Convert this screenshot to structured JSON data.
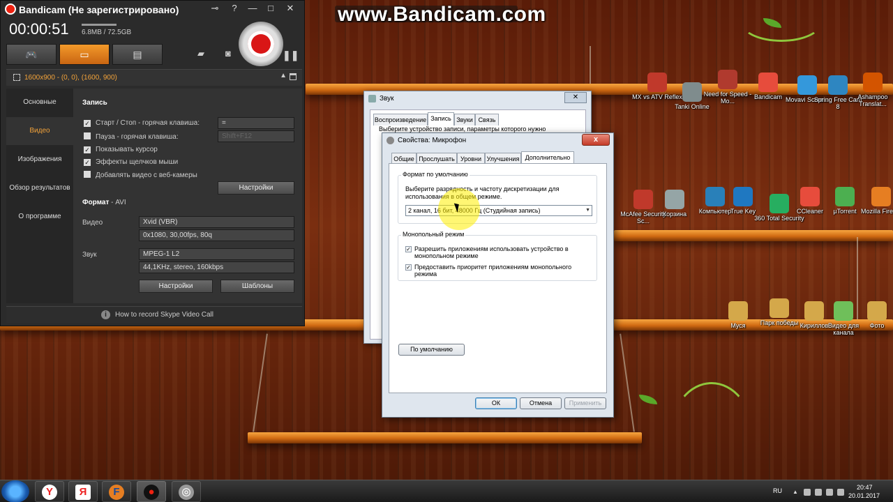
{
  "watermark": "www.Bandicam.com",
  "bandicam": {
    "title": "Bandicam (Не зарегистрировано)",
    "timer": "00:00:51",
    "size": "6.8MB / 72.5GB",
    "region": "1600x900 - (0, 0), (1600, 900)",
    "sidebar": [
      "Основные",
      "Видео",
      "Изображения",
      "Обзор результатов",
      "О программе"
    ],
    "record_section": "Запись",
    "checks": [
      {
        "label": "Старт / Стоп - горячая клавиша:",
        "checked": true
      },
      {
        "label": "Пауза - горячая клавиша:",
        "checked": false
      },
      {
        "label": "Показывать курсор",
        "checked": true
      },
      {
        "label": "Эффекты щелчков мыши",
        "checked": true
      },
      {
        "label": "Добавлять видео с веб-камеры",
        "checked": false
      }
    ],
    "hotkey_start": "=",
    "hotkey_pause": "Shift+F12",
    "settings_button": "Настройки",
    "format_label": "Формат",
    "format_value": "- AVI",
    "video_label": "Видео",
    "video_codec": "Xvid (VBR)",
    "video_params": "0x1080, 30,00fps, 80q",
    "audio_label": "Звук",
    "audio_codec": "MPEG-1 L2",
    "audio_params": "44,1KHz, stereo, 160kbps",
    "settings_button2": "Настройки",
    "templates_button": "Шаблоны",
    "footer": "How to record Skype Video Call"
  },
  "sound_dialog": {
    "title": "Звук",
    "tabs": [
      "Воспроизведение",
      "Запись",
      "Звуки",
      "Связь"
    ],
    "active_tab": 1,
    "text": "Выберите устройство записи, параметры которого нужно"
  },
  "mic_dialog": {
    "title": "Свойства: Микрофон",
    "close": "x",
    "tabs": [
      "Общие",
      "Прослушать",
      "Уровни",
      "Улучшения",
      "Дополнительно"
    ],
    "active_tab": 4,
    "default_format_group": "Формат по умолчанию",
    "default_format_text": "Выберите разрядность и частоту дискретизации для использования в общем режиме.",
    "format_value": "2 канал, 16 бит, 48000 Гц (Студийная запись)",
    "exclusive_group": "Монопольный режим",
    "exclusive_check1": "Разрешить приложениям использовать устройство в монопольном режиме",
    "exclusive_check2": "Предоставить приоритет приложениям монопольного режима",
    "default_button": "По умолчанию",
    "ok": "ОК",
    "cancel": "Отмена",
    "apply": "Применить"
  },
  "desktop_icons": [
    {
      "label": "MX vs ATV Reflex",
      "color": "#c0392b"
    },
    {
      "label": "Tanki Online",
      "color": "#7f8c8d"
    },
    {
      "label": "Need for Speed - Mo...",
      "color": "#b03a2e"
    },
    {
      "label": "Bandicam",
      "color": "#e74c3c"
    },
    {
      "label": "Movavi Scree...",
      "color": "#3498db"
    },
    {
      "label": "Spring Free Cam 8",
      "color": "#2e86c1"
    },
    {
      "label": "Ashampoo Translat...",
      "color": "#d35400"
    },
    {
      "label": "McAfee Security Sc...",
      "color": "#c0392b"
    },
    {
      "label": "Корзина",
      "color": "#95a5a6"
    },
    {
      "label": "Компьютер",
      "color": "#2980b9"
    },
    {
      "label": "True Key",
      "color": "#1f78c1"
    },
    {
      "label": "360 Total Security",
      "color": "#27ae60"
    },
    {
      "label": "CCleaner",
      "color": "#e74c3c"
    },
    {
      "label": "µTorrent",
      "color": "#4caf50"
    },
    {
      "label": "Mozilla Firefox",
      "color": "#e67e22"
    },
    {
      "label": "Муся",
      "color": "#d4a84a"
    },
    {
      "label": "Парк победы",
      "color": "#d4a84a"
    },
    {
      "label": "Кириллов",
      "color": "#d4a84a"
    },
    {
      "label": "Видео для канала",
      "color": "#6fbf5a"
    },
    {
      "label": "Фото",
      "color": "#d4a84a"
    }
  ],
  "taskbar": {
    "items": [
      "Y",
      "Я",
      "F",
      "●",
      "◎"
    ],
    "lang": "RU",
    "time": "20:47",
    "date": "20.01.2017"
  }
}
